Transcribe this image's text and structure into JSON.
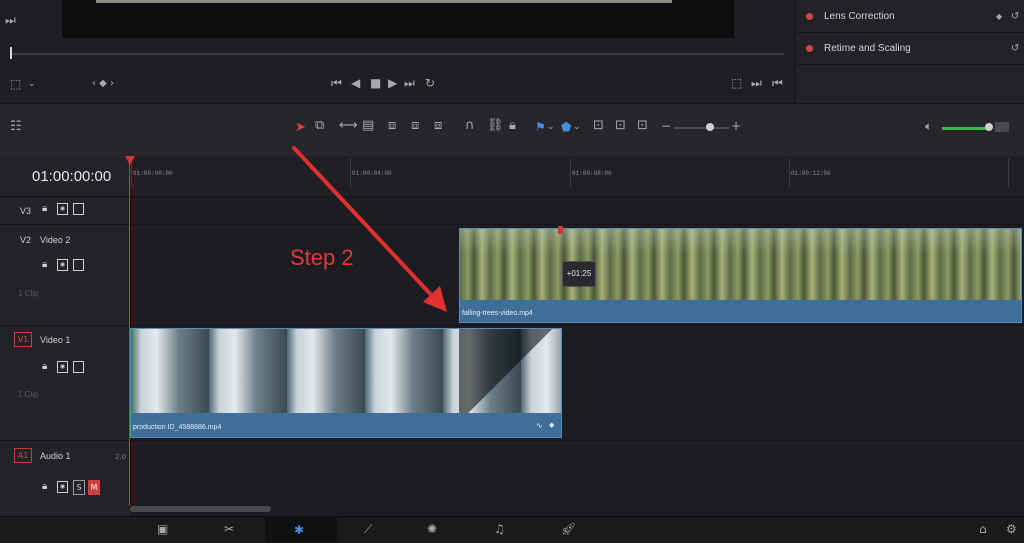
{
  "inspector": {
    "items": [
      {
        "label": "Lens Correction"
      },
      {
        "label": "Retime and Scaling"
      }
    ]
  },
  "timeline": {
    "timecode": "01:00:00:00",
    "ruler_ticks": [
      "01:00:00:00",
      "01:00:04:00",
      "01:00:08:00",
      "01:00:12:00"
    ],
    "tracks": {
      "v3": {
        "id": "V3"
      },
      "v2": {
        "id": "V2",
        "name": "Video 2",
        "clips": "1 Clip"
      },
      "v1": {
        "id": "V1",
        "name": "Video 1",
        "clips": "1 Clip"
      },
      "a1": {
        "id": "A1",
        "name": "Audio 1",
        "channels": "2.0",
        "solo": "S",
        "mute": "M"
      }
    },
    "clips": {
      "v2_clip": {
        "name": "falling-trees-video.mp4",
        "retime_badge": "+01:25"
      },
      "v1_clip": {
        "name": "production ID_4588686.mp4"
      }
    }
  },
  "annotation": {
    "text": "Step 2",
    "color": "#e03a3a"
  },
  "colors": {
    "clip_blue": "#3f6e98",
    "playhead": "#d0363a",
    "mute": "#d04040"
  }
}
